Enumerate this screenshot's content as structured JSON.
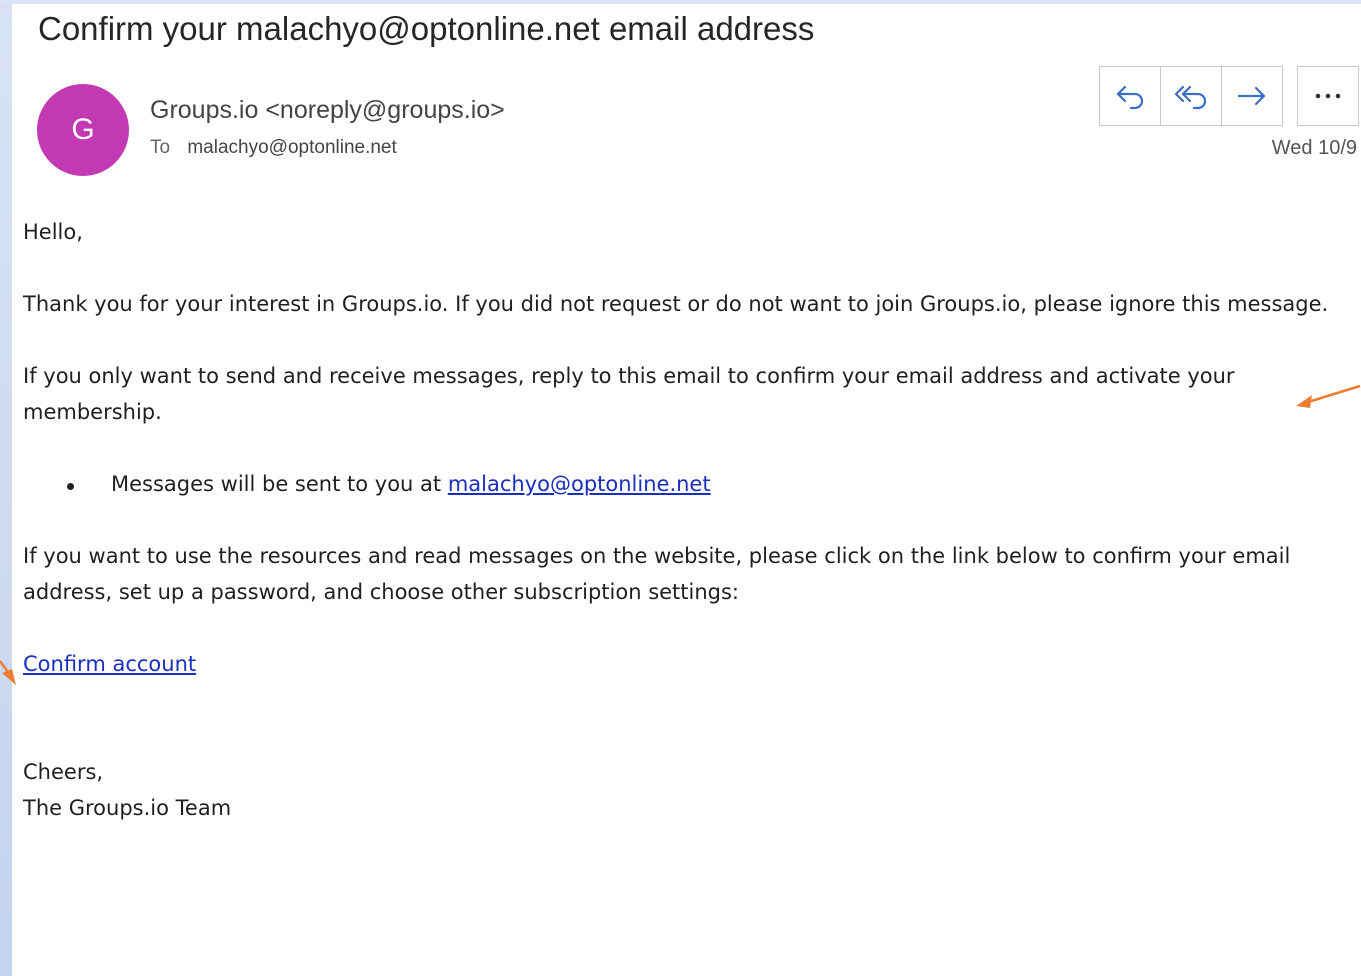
{
  "email": {
    "subject": "Confirm your malachyo@optonline.net email address",
    "avatar_initial": "G",
    "avatar_color": "#c239b3",
    "sender": "Groups.io <noreply@groups.io>",
    "to_label": "To",
    "to_address": "malachyo@optonline.net",
    "date": "Wed 10/9",
    "actions": {
      "reply_icon": "reply-icon",
      "reply_all_icon": "reply-all-icon",
      "forward_icon": "forward-icon",
      "more_label": "..."
    }
  },
  "body": {
    "greeting": "Hello,",
    "para1": "Thank you for your interest in Groups.io. If you did not request or do not want to join Groups.io, please ignore this message.",
    "para2": "If you only want to send and receive messages, reply to this email to confirm your email address and activate your membership.",
    "bullet_prefix": "Messages will be sent to you at ",
    "bullet_link": "malachyo@optonline.net",
    "para3": "If you want to use the resources and read messages on the website, please click on the link below to confirm your email address, set up a password, and choose other subscription settings:",
    "confirm_link": "Confirm account",
    "signoff": "Cheers,",
    "signature": "The Groups.io Team"
  },
  "colors": {
    "link": "#1a2fbf",
    "accent_icon": "#3b6fc4",
    "annotation_arrow": "#ed7d31"
  }
}
